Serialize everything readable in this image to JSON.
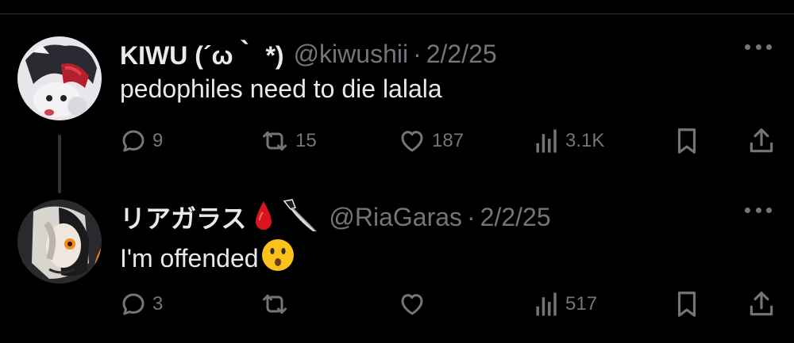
{
  "tweets": [
    {
      "name": "KIWU (´ω｀ *)",
      "handle": "@kiwushii",
      "separator": "·",
      "date": "2/2/25",
      "text": "pedophiles need to die lalala",
      "replies": "9",
      "retweets": "15",
      "likes": "187",
      "views": "3.1K"
    },
    {
      "name": "リアガラス",
      "name_emojis": [
        "blood-drop-icon",
        "knife-icon"
      ],
      "handle": "@RiaGaras",
      "separator": "·",
      "date": "2/2/25",
      "text": "I'm offended",
      "text_emoji": "hushed-face-icon",
      "replies": "3",
      "retweets": "",
      "likes": "",
      "views": "517"
    }
  ],
  "colors": {
    "background": "#000000",
    "primary_text": "#e7e9ea",
    "secondary_text": "#71767b",
    "divider": "#2f3336",
    "thread_line": "#333639"
  }
}
